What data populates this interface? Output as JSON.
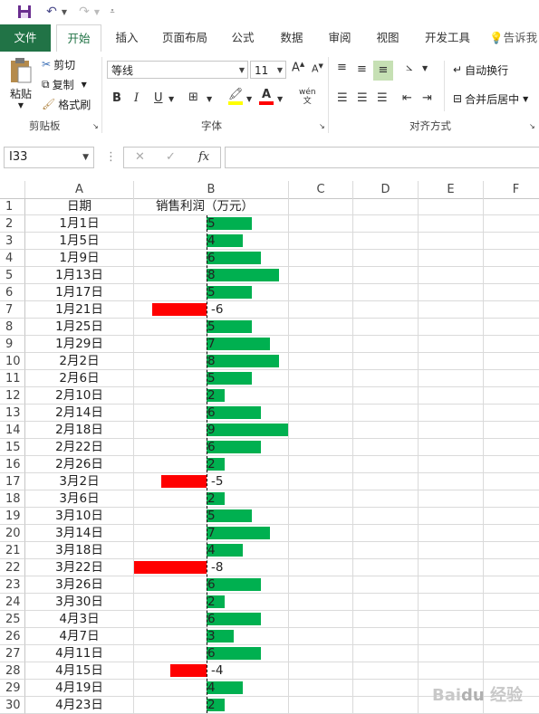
{
  "qat": {
    "save_icon": "save-icon",
    "undo_icon": "undo-icon",
    "redo_icon": "redo-icon",
    "customize_icon": "customize-qat-icon"
  },
  "tabs": [
    "文件",
    "开始",
    "插入",
    "页面布局",
    "公式",
    "数据",
    "审阅",
    "视图",
    "开发工具"
  ],
  "tell_me": "告诉我",
  "clipboard": {
    "paste": "粘贴",
    "cut": "剪切",
    "copy": "复制",
    "format_painter": "格式刷",
    "group": "剪贴板"
  },
  "font": {
    "name": "等线",
    "size": "11",
    "bold": "B",
    "italic": "I",
    "underline": "U",
    "group": "字体"
  },
  "alignment": {
    "wrap": "自动换行",
    "merge": "合并后居中",
    "group": "对齐方式"
  },
  "formula_bar": {
    "name_box": "I33",
    "cancel": "✕",
    "enter": "✓",
    "fx": "fx",
    "value": ""
  },
  "columns": [
    "A",
    "B",
    "C",
    "D",
    "E",
    "F"
  ],
  "header_row": {
    "row": "1",
    "a": "日期",
    "b": "销售利润（万元）"
  },
  "colors": {
    "positive": "#00b050",
    "negative": "#ff0000",
    "excel_green": "#217346"
  },
  "rows": [
    {
      "row": "2",
      "date": "1月1日",
      "value": 5
    },
    {
      "row": "3",
      "date": "1月5日",
      "value": 4
    },
    {
      "row": "4",
      "date": "1月9日",
      "value": 6
    },
    {
      "row": "5",
      "date": "1月13日",
      "value": 8
    },
    {
      "row": "6",
      "date": "1月17日",
      "value": 5
    },
    {
      "row": "7",
      "date": "1月21日",
      "value": -6
    },
    {
      "row": "8",
      "date": "1月25日",
      "value": 5
    },
    {
      "row": "9",
      "date": "1月29日",
      "value": 7
    },
    {
      "row": "10",
      "date": "2月2日",
      "value": 8
    },
    {
      "row": "11",
      "date": "2月6日",
      "value": 5
    },
    {
      "row": "12",
      "date": "2月10日",
      "value": 2
    },
    {
      "row": "13",
      "date": "2月14日",
      "value": 6
    },
    {
      "row": "14",
      "date": "2月18日",
      "value": 9
    },
    {
      "row": "15",
      "date": "2月22日",
      "value": 6
    },
    {
      "row": "16",
      "date": "2月26日",
      "value": 2
    },
    {
      "row": "17",
      "date": "3月2日",
      "value": -5
    },
    {
      "row": "18",
      "date": "3月6日",
      "value": 2
    },
    {
      "row": "19",
      "date": "3月10日",
      "value": 5
    },
    {
      "row": "20",
      "date": "3月14日",
      "value": 7
    },
    {
      "row": "21",
      "date": "3月18日",
      "value": 4
    },
    {
      "row": "22",
      "date": "3月22日",
      "value": -8
    },
    {
      "row": "23",
      "date": "3月26日",
      "value": 6
    },
    {
      "row": "24",
      "date": "3月30日",
      "value": 2
    },
    {
      "row": "25",
      "date": "4月3日",
      "value": 6
    },
    {
      "row": "26",
      "date": "4月7日",
      "value": 3
    },
    {
      "row": "27",
      "date": "4月11日",
      "value": 6
    },
    {
      "row": "28",
      "date": "4月15日",
      "value": -4
    },
    {
      "row": "29",
      "date": "4月19日",
      "value": 4
    },
    {
      "row": "30",
      "date": "4月23日",
      "value": 2
    }
  ]
}
